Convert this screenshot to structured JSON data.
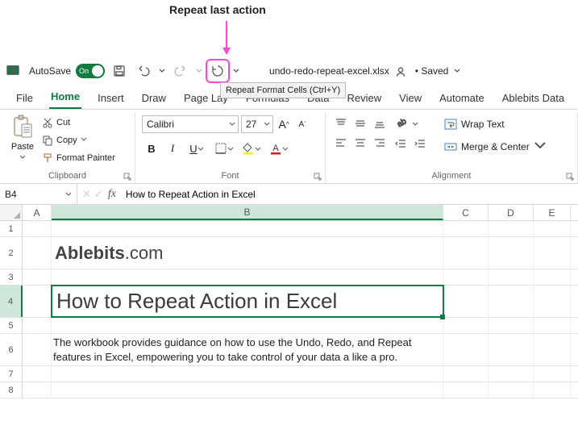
{
  "annotation": {
    "label": "Repeat last action"
  },
  "qat": {
    "autosave_label": "AutoSave",
    "autosave_state": "On",
    "filename": "undo-redo-repeat-excel.xlsx",
    "saved_status": "• Saved"
  },
  "tooltip": "Repeat Format Cells (Ctrl+Y)",
  "tabs": [
    "File",
    "Home",
    "Insert",
    "Draw",
    "Page Lay",
    "Formulas",
    "Data",
    "Review",
    "View",
    "Automate",
    "Ablebits Data"
  ],
  "active_tab": "Home",
  "ribbon": {
    "clipboard": {
      "label": "Clipboard",
      "paste": "Paste",
      "cut": "Cut",
      "copy": "Copy",
      "format_painter": "Format Painter"
    },
    "font": {
      "label": "Font",
      "name": "Calibri",
      "size": "27",
      "increase": "A",
      "decrease": "A",
      "bold": "B",
      "italic": "I",
      "underline": "U"
    },
    "alignment": {
      "label": "Alignment",
      "wrap": "Wrap Text",
      "merge": "Merge & Center"
    }
  },
  "namebox": {
    "ref": "B4"
  },
  "formula_bar": {
    "value": "How to Repeat Action in Excel"
  },
  "columns": [
    "A",
    "B",
    "C",
    "D",
    "E"
  ],
  "rows": {
    "r2_logo_brand": "Ablebits",
    "r2_logo_suffix": ".com",
    "r4_title": "How to Repeat Action in Excel",
    "r56_desc": "The workbook provides guidance on how to use the Undo, Redo, and Repeat features in Excel, empowering you to take control of your data a like a pro."
  }
}
